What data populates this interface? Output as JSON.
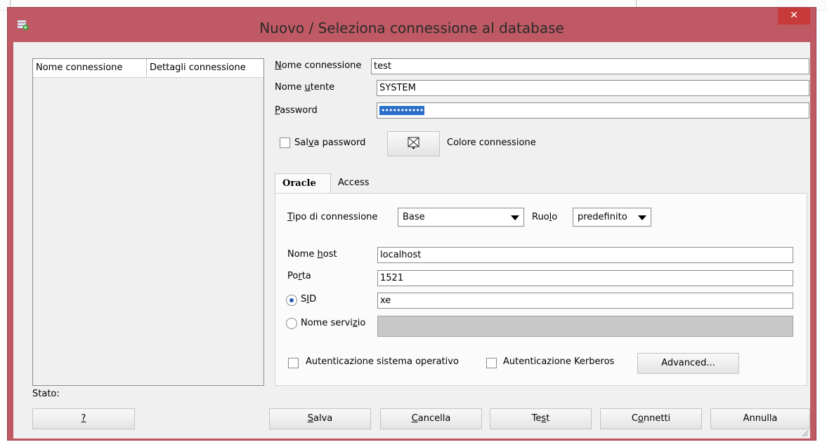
{
  "window": {
    "title": "Nuovo / Seleziona connessione al database",
    "close_symbol": "✕"
  },
  "connections_list": {
    "columns": [
      "Nome connessione",
      "Dettagli connessione"
    ],
    "rows": []
  },
  "form": {
    "connection_name": {
      "label": "Nome connessione",
      "label_u": "N",
      "label_rest": "ome connessione",
      "value": "test"
    },
    "username": {
      "label_pre": "Nome ",
      "label_u": "u",
      "label_rest": "tente",
      "value": "SYSTEM"
    },
    "password": {
      "label_u": "P",
      "label_rest": "assword",
      "value": "•••••••••••"
    },
    "save_password": {
      "label_pre": "Sal",
      "label_u": "v",
      "label_rest": "a password",
      "checked": false
    },
    "color_button_icon": "envelope-dropdown-icon",
    "connection_color_label": "Colore connessione"
  },
  "tabs": [
    {
      "label": "Oracle",
      "active": true
    },
    {
      "label": "Access",
      "active": false
    }
  ],
  "oracle": {
    "connection_type": {
      "label_u": "T",
      "label_rest": "ipo di connessione",
      "value": "Base"
    },
    "role": {
      "label_pre": "Ruo",
      "label_u": "l",
      "label_rest": "o",
      "value": "predefinito"
    },
    "host": {
      "label_pre": "Nome ",
      "label_u": "h",
      "label_rest": "ost",
      "value": "localhost"
    },
    "port": {
      "label_pre": "Po",
      "label_u": "r",
      "label_rest": "ta",
      "value": "1521"
    },
    "sid": {
      "label_pre": "S",
      "label_u": "I",
      "label_rest": "D",
      "value": "xe",
      "selected": true
    },
    "service_name": {
      "label_pre": "Nome servi",
      "label_u": "z",
      "label_rest": "io",
      "value": "",
      "selected": false
    },
    "os_auth": {
      "label": "Autenticazione sistema operativo",
      "checked": false
    },
    "kerberos_auth": {
      "label": "Autenticazione Kerberos",
      "checked": false
    },
    "advanced_label": "Advanced..."
  },
  "status_label": "Stato:",
  "buttons": {
    "help": "?",
    "save": {
      "u": "S",
      "rest": "alva"
    },
    "delete": {
      "u": "C",
      "rest": "ancella"
    },
    "test": {
      "pre": "Te",
      "u": "s",
      "rest": "t"
    },
    "connect": {
      "pre": "C",
      "u": "o",
      "rest": "nnetti"
    },
    "cancel": "Annulla"
  },
  "colors": {
    "window_frame": "#bf5a64",
    "close_button": "#c83a3a",
    "selection": "#2a6fc9",
    "client": "#f0f0f0"
  }
}
